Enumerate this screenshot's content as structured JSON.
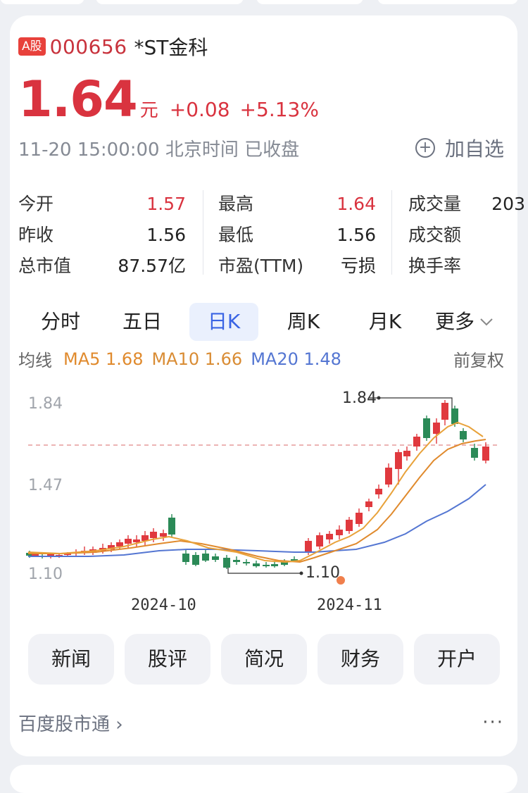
{
  "stock": {
    "market_badge": "A股",
    "code": "000656",
    "name": "*ST金科",
    "price": "1.64",
    "unit": "元",
    "change": "+0.08",
    "change_pct": "+5.13%",
    "timestamp": "11-20 15:00:00 北京时间 已收盘",
    "watch_label": "加自选"
  },
  "stats": [
    {
      "label": "今开",
      "value": "1.57",
      "color": "red"
    },
    {
      "label": "最高",
      "value": "1.64",
      "color": "red"
    },
    {
      "label": "成交量",
      "value": "203"
    },
    {
      "label": "昨收",
      "value": "1.56"
    },
    {
      "label": "最低",
      "value": "1.56"
    },
    {
      "label": "成交额",
      "value": ""
    },
    {
      "label": "总市值",
      "value": "87.57亿"
    },
    {
      "label": "市盈(TTM)",
      "value": "亏损"
    },
    {
      "label": "换手率",
      "value": ""
    }
  ],
  "tabs": [
    "分时",
    "五日",
    "日K",
    "周K",
    "月K",
    "更多"
  ],
  "active_tab": "日K",
  "ma": {
    "title": "均线",
    "ma5": "MA5 1.68",
    "ma10": "MA10 1.66",
    "ma20": "MA20 1.48",
    "adjust": "前复权"
  },
  "chart_data": {
    "type": "candlestick",
    "y_ticks": [
      "1.84",
      "1.47",
      "1.10"
    ],
    "x_ticks": [
      "2024-10",
      "2024-11"
    ],
    "high_marker": "1.84",
    "low_marker": "1.10",
    "reference_price": 1.56,
    "ylim": [
      1.1,
      1.84
    ],
    "colors": {
      "up": "#e0393e",
      "down": "#2b8a57",
      "ma5": "#e8a23a",
      "ma10": "#e08a2d",
      "ma20": "#5476d2"
    }
  },
  "buttons": [
    "新闻",
    "股评",
    "简况",
    "财务",
    "开户"
  ],
  "footer": {
    "source": "百度股市通 ›",
    "more": "···"
  }
}
